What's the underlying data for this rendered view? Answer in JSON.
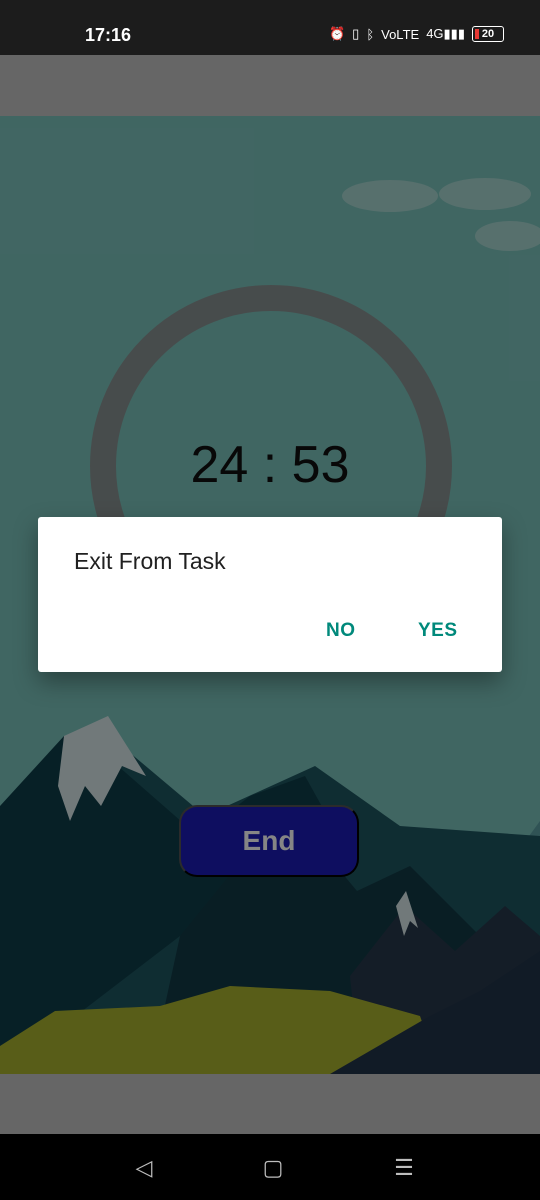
{
  "status": {
    "time": "17:16",
    "icons": [
      "alarm-icon",
      "vibrate-icon",
      "bluetooth-icon",
      "volte-icon",
      "signal-4g-icon"
    ],
    "battery_level": "20"
  },
  "timer": {
    "value": "24 : 53"
  },
  "actions": {
    "end_label": "End"
  },
  "dialog": {
    "title": "Exit From Task",
    "no_label": "NO",
    "yes_label": "YES"
  },
  "nav": {
    "icons": [
      "back-icon",
      "home-icon",
      "recents-icon"
    ]
  },
  "colors": {
    "status_bar": "#1c1c1c",
    "scene_sky": "#7cc4bd",
    "dialog_button": "#00897b",
    "end_button": "#1b1bb8"
  }
}
